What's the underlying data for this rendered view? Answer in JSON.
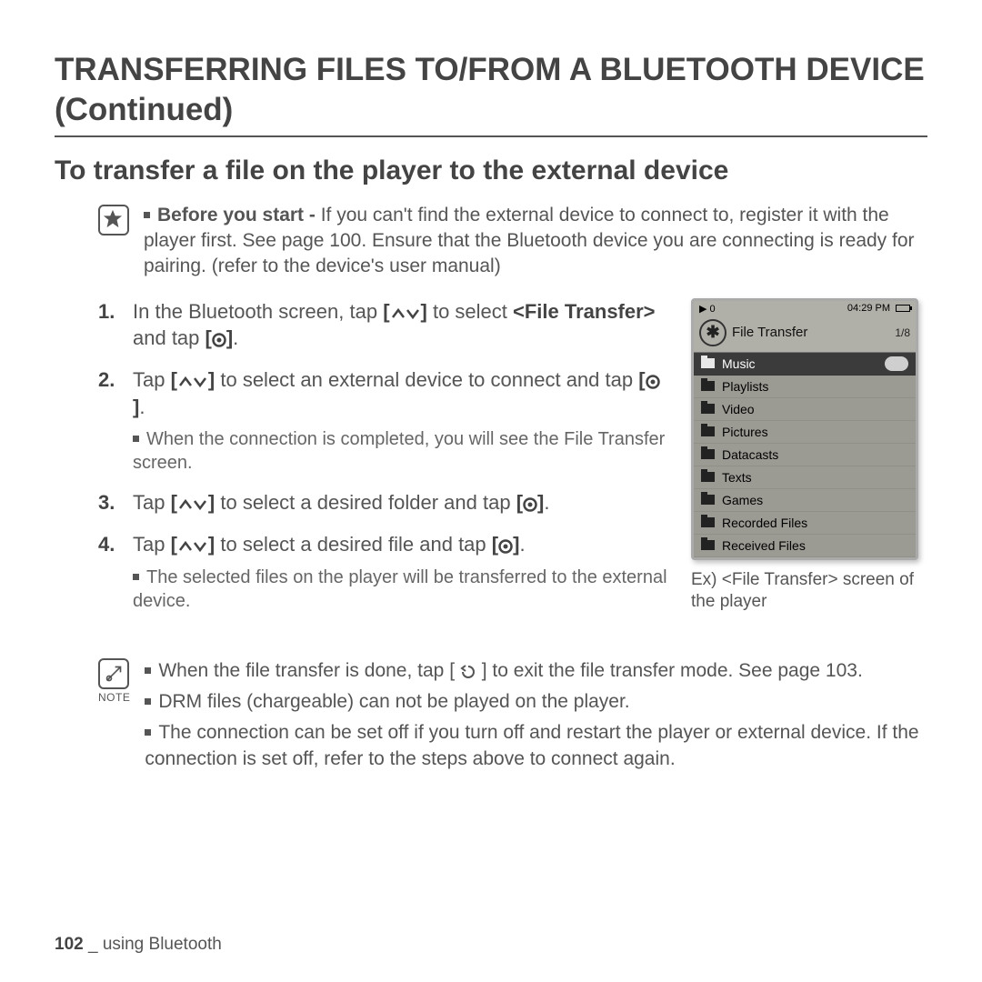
{
  "title": "TRANSFERRING FILES TO/FROM A BLUETOOTH DEVICE (Continued)",
  "subtitle": "To transfer a file on the player to the external device",
  "before": {
    "lead": "Before you start -",
    "text": "If you can't find the external device to connect to, register it with the player first. See page 100. Ensure that the Bluetooth device you are connecting is ready for pairing. (refer to the device's user manual)"
  },
  "steps": [
    {
      "pre": "In the Bluetooth screen, tap ",
      "mid": " to select ",
      "bold": "<File Transfer>",
      "post1": " and tap ",
      "post2": "."
    },
    {
      "pre": "Tap ",
      "mid": " to select an external device to connect and tap ",
      "post2": ".",
      "sub": "When the connection is completed, you will see the File Transfer screen."
    },
    {
      "pre": "Tap ",
      "mid": " to select a desired folder and tap ",
      "post2": "."
    },
    {
      "pre": "Tap ",
      "mid": " to select a desired file and tap ",
      "post2": ".",
      "sub": "The selected files on the player will be transferred to the external device."
    }
  ],
  "device": {
    "play_indicator": "▶ 0",
    "time": "04:29 PM",
    "header": "File Transfer",
    "count": "1/8",
    "items": [
      "Music",
      "Playlists",
      "Video",
      "Pictures",
      "Datacasts",
      "Texts",
      "Games",
      "Recorded Files",
      "Received Files"
    ],
    "selected_index": 0
  },
  "caption": "Ex) <File Transfer> screen of the player",
  "notes": {
    "label": "NOTE",
    "items": [
      {
        "pre": "When the file transfer is done, tap ",
        "post": " to exit the file transfer mode. See page 103."
      },
      {
        "text": "DRM files (chargeable) can not be played on the player."
      },
      {
        "text": "The connection can be set off if you turn off and restart the player or external device. If the connection is set off, refer to the steps above to connect again."
      }
    ]
  },
  "footer": {
    "page": "102",
    "sep": " _ ",
    "section": "using Bluetooth"
  }
}
